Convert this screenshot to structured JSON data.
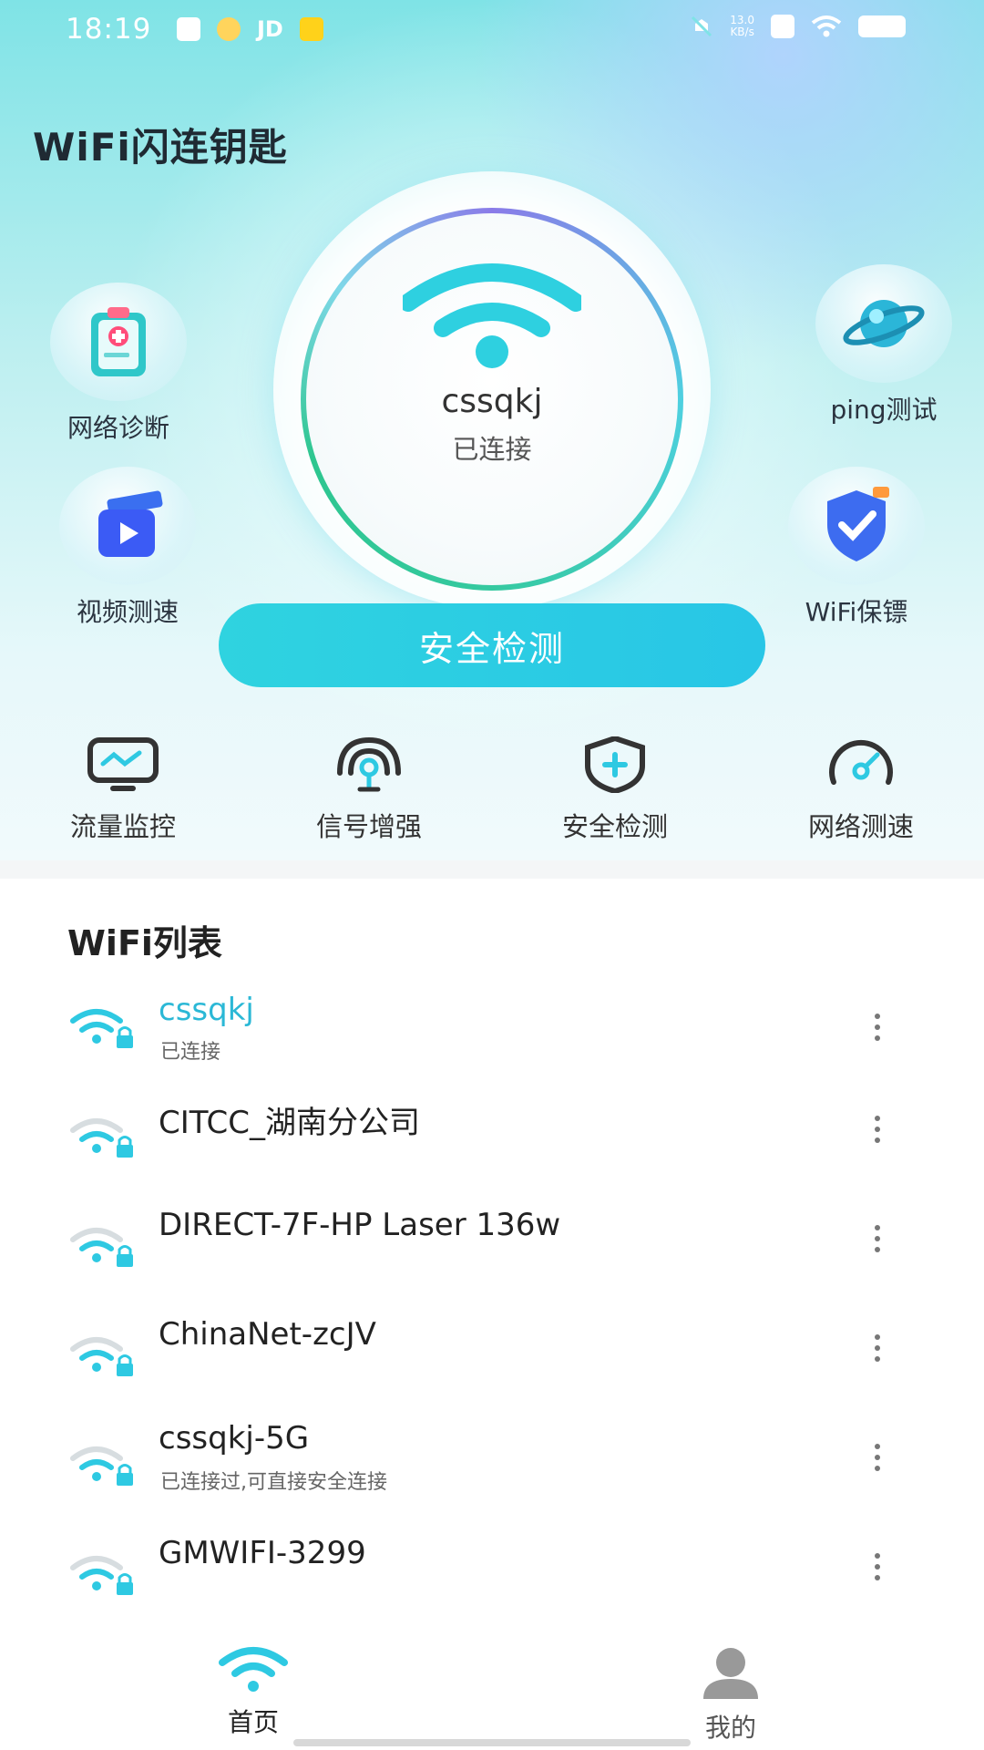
{
  "status_bar": {
    "time": "18:19",
    "jd": "JD",
    "net_speed_value": "13.0",
    "net_speed_unit": "KB/s"
  },
  "header": {
    "app_title": "WiFi闪连钥匙"
  },
  "current": {
    "ssid": "cssqkj",
    "status": "已连接"
  },
  "features": {
    "diagnose": "网络诊断",
    "ping": "ping测试",
    "video_speed": "视频测速",
    "guard": "WiFi保镖"
  },
  "cta_label": "安全检测",
  "tools": [
    {
      "label": "流量监控",
      "icon": "traffic-monitor-icon"
    },
    {
      "label": "信号增强",
      "icon": "signal-boost-icon"
    },
    {
      "label": "安全检测",
      "icon": "security-shield-icon"
    },
    {
      "label": "网络测速",
      "icon": "speedometer-icon"
    }
  ],
  "wifi_list": {
    "title": "WiFi列表",
    "items": [
      {
        "name": "cssqkj",
        "sub": "已连接"
      },
      {
        "name": "CITCC_湖南分公司",
        "sub": ""
      },
      {
        "name": "DIRECT-7F-HP Laser 136w",
        "sub": ""
      },
      {
        "name": "ChinaNet-zcJV",
        "sub": ""
      },
      {
        "name": "cssqkj-5G",
        "sub": "已连接过,可直接安全连接"
      },
      {
        "name": "GMWIFI-3299",
        "sub": ""
      }
    ]
  },
  "tabbar": {
    "home": "首页",
    "mine": "我的"
  },
  "colors": {
    "accent": "#2ec9e2",
    "cta": "#2fd3e0",
    "connected_text": "#2bb8d6",
    "inactive": "#999999"
  }
}
